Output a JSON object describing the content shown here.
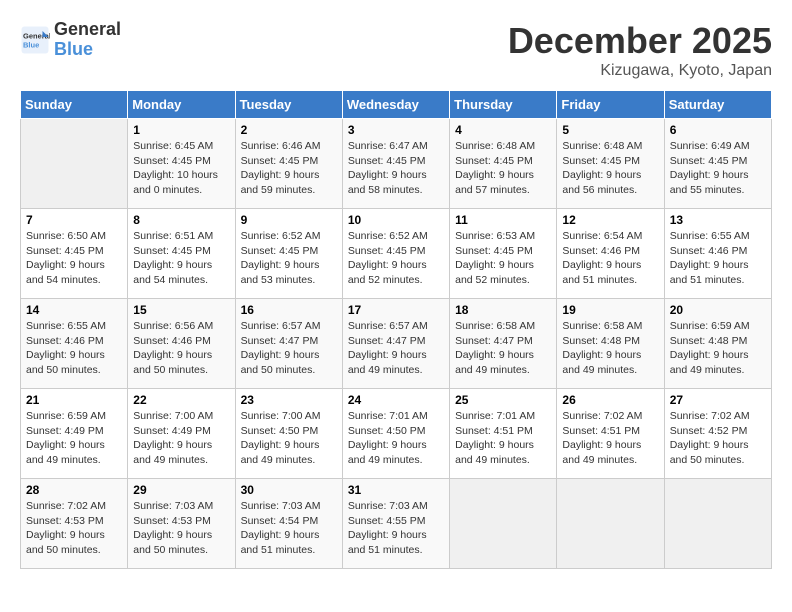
{
  "logo": {
    "line1": "General",
    "line2": "Blue"
  },
  "title": "December 2025",
  "location": "Kizugawa, Kyoto, Japan",
  "days_of_week": [
    "Sunday",
    "Monday",
    "Tuesday",
    "Wednesday",
    "Thursday",
    "Friday",
    "Saturday"
  ],
  "weeks": [
    [
      {
        "day": "",
        "info": ""
      },
      {
        "day": "1",
        "info": "Sunrise: 6:45 AM\nSunset: 4:45 PM\nDaylight: 10 hours\nand 0 minutes."
      },
      {
        "day": "2",
        "info": "Sunrise: 6:46 AM\nSunset: 4:45 PM\nDaylight: 9 hours\nand 59 minutes."
      },
      {
        "day": "3",
        "info": "Sunrise: 6:47 AM\nSunset: 4:45 PM\nDaylight: 9 hours\nand 58 minutes."
      },
      {
        "day": "4",
        "info": "Sunrise: 6:48 AM\nSunset: 4:45 PM\nDaylight: 9 hours\nand 57 minutes."
      },
      {
        "day": "5",
        "info": "Sunrise: 6:48 AM\nSunset: 4:45 PM\nDaylight: 9 hours\nand 56 minutes."
      },
      {
        "day": "6",
        "info": "Sunrise: 6:49 AM\nSunset: 4:45 PM\nDaylight: 9 hours\nand 55 minutes."
      }
    ],
    [
      {
        "day": "7",
        "info": "Sunrise: 6:50 AM\nSunset: 4:45 PM\nDaylight: 9 hours\nand 54 minutes."
      },
      {
        "day": "8",
        "info": "Sunrise: 6:51 AM\nSunset: 4:45 PM\nDaylight: 9 hours\nand 54 minutes."
      },
      {
        "day": "9",
        "info": "Sunrise: 6:52 AM\nSunset: 4:45 PM\nDaylight: 9 hours\nand 53 minutes."
      },
      {
        "day": "10",
        "info": "Sunrise: 6:52 AM\nSunset: 4:45 PM\nDaylight: 9 hours\nand 52 minutes."
      },
      {
        "day": "11",
        "info": "Sunrise: 6:53 AM\nSunset: 4:45 PM\nDaylight: 9 hours\nand 52 minutes."
      },
      {
        "day": "12",
        "info": "Sunrise: 6:54 AM\nSunset: 4:46 PM\nDaylight: 9 hours\nand 51 minutes."
      },
      {
        "day": "13",
        "info": "Sunrise: 6:55 AM\nSunset: 4:46 PM\nDaylight: 9 hours\nand 51 minutes."
      }
    ],
    [
      {
        "day": "14",
        "info": "Sunrise: 6:55 AM\nSunset: 4:46 PM\nDaylight: 9 hours\nand 50 minutes."
      },
      {
        "day": "15",
        "info": "Sunrise: 6:56 AM\nSunset: 4:46 PM\nDaylight: 9 hours\nand 50 minutes."
      },
      {
        "day": "16",
        "info": "Sunrise: 6:57 AM\nSunset: 4:47 PM\nDaylight: 9 hours\nand 50 minutes."
      },
      {
        "day": "17",
        "info": "Sunrise: 6:57 AM\nSunset: 4:47 PM\nDaylight: 9 hours\nand 49 minutes."
      },
      {
        "day": "18",
        "info": "Sunrise: 6:58 AM\nSunset: 4:47 PM\nDaylight: 9 hours\nand 49 minutes."
      },
      {
        "day": "19",
        "info": "Sunrise: 6:58 AM\nSunset: 4:48 PM\nDaylight: 9 hours\nand 49 minutes."
      },
      {
        "day": "20",
        "info": "Sunrise: 6:59 AM\nSunset: 4:48 PM\nDaylight: 9 hours\nand 49 minutes."
      }
    ],
    [
      {
        "day": "21",
        "info": "Sunrise: 6:59 AM\nSunset: 4:49 PM\nDaylight: 9 hours\nand 49 minutes."
      },
      {
        "day": "22",
        "info": "Sunrise: 7:00 AM\nSunset: 4:49 PM\nDaylight: 9 hours\nand 49 minutes."
      },
      {
        "day": "23",
        "info": "Sunrise: 7:00 AM\nSunset: 4:50 PM\nDaylight: 9 hours\nand 49 minutes."
      },
      {
        "day": "24",
        "info": "Sunrise: 7:01 AM\nSunset: 4:50 PM\nDaylight: 9 hours\nand 49 minutes."
      },
      {
        "day": "25",
        "info": "Sunrise: 7:01 AM\nSunset: 4:51 PM\nDaylight: 9 hours\nand 49 minutes."
      },
      {
        "day": "26",
        "info": "Sunrise: 7:02 AM\nSunset: 4:51 PM\nDaylight: 9 hours\nand 49 minutes."
      },
      {
        "day": "27",
        "info": "Sunrise: 7:02 AM\nSunset: 4:52 PM\nDaylight: 9 hours\nand 50 minutes."
      }
    ],
    [
      {
        "day": "28",
        "info": "Sunrise: 7:02 AM\nSunset: 4:53 PM\nDaylight: 9 hours\nand 50 minutes."
      },
      {
        "day": "29",
        "info": "Sunrise: 7:03 AM\nSunset: 4:53 PM\nDaylight: 9 hours\nand 50 minutes."
      },
      {
        "day": "30",
        "info": "Sunrise: 7:03 AM\nSunset: 4:54 PM\nDaylight: 9 hours\nand 51 minutes."
      },
      {
        "day": "31",
        "info": "Sunrise: 7:03 AM\nSunset: 4:55 PM\nDaylight: 9 hours\nand 51 minutes."
      },
      {
        "day": "",
        "info": ""
      },
      {
        "day": "",
        "info": ""
      },
      {
        "day": "",
        "info": ""
      }
    ]
  ]
}
